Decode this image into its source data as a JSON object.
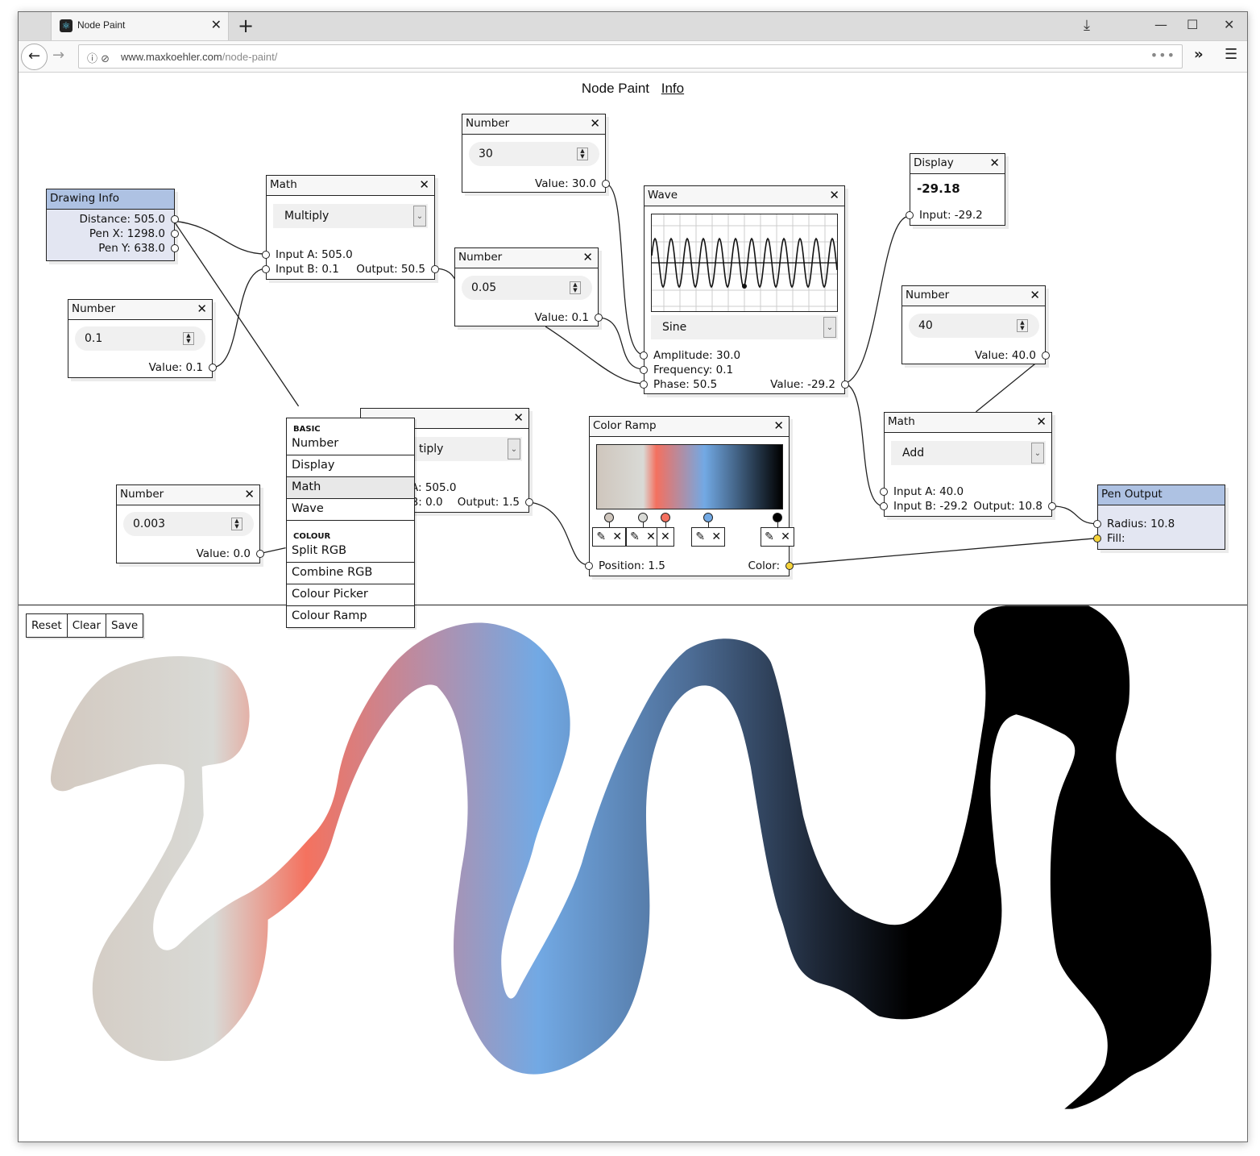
{
  "browser": {
    "tab_title": "Node Paint",
    "new_tab": "+",
    "tab_close": "✕",
    "url_host": "www.maxkoehler.com",
    "url_path": "/node-paint/",
    "url_more": "•••",
    "download_icon": "⤓",
    "minimize": "—",
    "maximize": "☐",
    "close": "✕",
    "back": "←",
    "forward": "→",
    "overflow": "»",
    "menu": "☰",
    "info_icon": "ⓘ",
    "tracking_icon": "⊘"
  },
  "header": {
    "title": "Node Paint",
    "info_link": "Info"
  },
  "nodes": {
    "drawing_info": {
      "title": "Drawing Info",
      "distance": "Distance: 505.0",
      "pen_x": "Pen X: 1298.0",
      "pen_y": "Pen Y: 638.0"
    },
    "math1": {
      "title": "Math",
      "operation": "Multiply",
      "input_a": "Input A: 505.0",
      "input_b": "Input B: 0.1",
      "output": "Output: 50.5"
    },
    "number_0_1": {
      "title": "Number",
      "value_input": "0.1",
      "value": "Value: 0.1"
    },
    "number_30": {
      "title": "Number",
      "value_input": "30",
      "value": "Value: 30.0"
    },
    "number_0_05": {
      "title": "Number",
      "value_input": "0.05",
      "value": "Value: 0.1"
    },
    "wave": {
      "title": "Wave",
      "type": "Sine",
      "amplitude": "Amplitude: 30.0",
      "frequency": "Frequency: 0.1",
      "phase": "Phase: 50.5",
      "value": "Value: -29.2",
      "amplitude_val": 30,
      "frequency_val": 0.1
    },
    "display": {
      "title": "Display",
      "big_value": "-29.18",
      "input": "Input: -29.2"
    },
    "number_40": {
      "title": "Number",
      "value_input": "40",
      "value": "Value: 40.0"
    },
    "math2": {
      "title": "Math",
      "operation": "Add",
      "input_a": "Input A: 40.0",
      "input_b": "Input B: -29.2",
      "output": "Output: 10.8"
    },
    "pen_output": {
      "title": "Pen Output",
      "radius": "Radius: 10.8",
      "fill": "Fill:"
    },
    "math3": {
      "operation_partial": "tiply",
      "input_a_partial": "A: 505.0",
      "input_b_partial": "B: 0.0",
      "output": "Output: 1.5"
    },
    "number_0_003": {
      "title": "Number",
      "value_input": "0.003",
      "value": "Value: 0.0"
    },
    "color_ramp": {
      "title": "Color Ramp",
      "position": "Position: 1.5",
      "color": "Color:",
      "stops": [
        {
          "pos": 0.07,
          "color": "#cfc6bd"
        },
        {
          "pos": 0.25,
          "color": "#d9dad6"
        },
        {
          "pos": 0.37,
          "color": "#f4705f"
        },
        {
          "pos": 0.6,
          "color": "#72a9e4"
        },
        {
          "pos": 0.97,
          "color": "#000000"
        }
      ]
    }
  },
  "close_glyph": "✕",
  "edit_glyph": "✎",
  "menu": {
    "sections": [
      {
        "label": "BASIC",
        "items": [
          "Number",
          "Display",
          "Math",
          "Wave"
        ]
      },
      {
        "label": "COLOUR",
        "items": [
          "Split RGB",
          "Combine RGB",
          "Colour Picker",
          "Colour Ramp"
        ]
      }
    ],
    "highlighted": "Math"
  },
  "toolbar": {
    "reset": "Reset",
    "clear": "Clear",
    "save": "Save"
  }
}
